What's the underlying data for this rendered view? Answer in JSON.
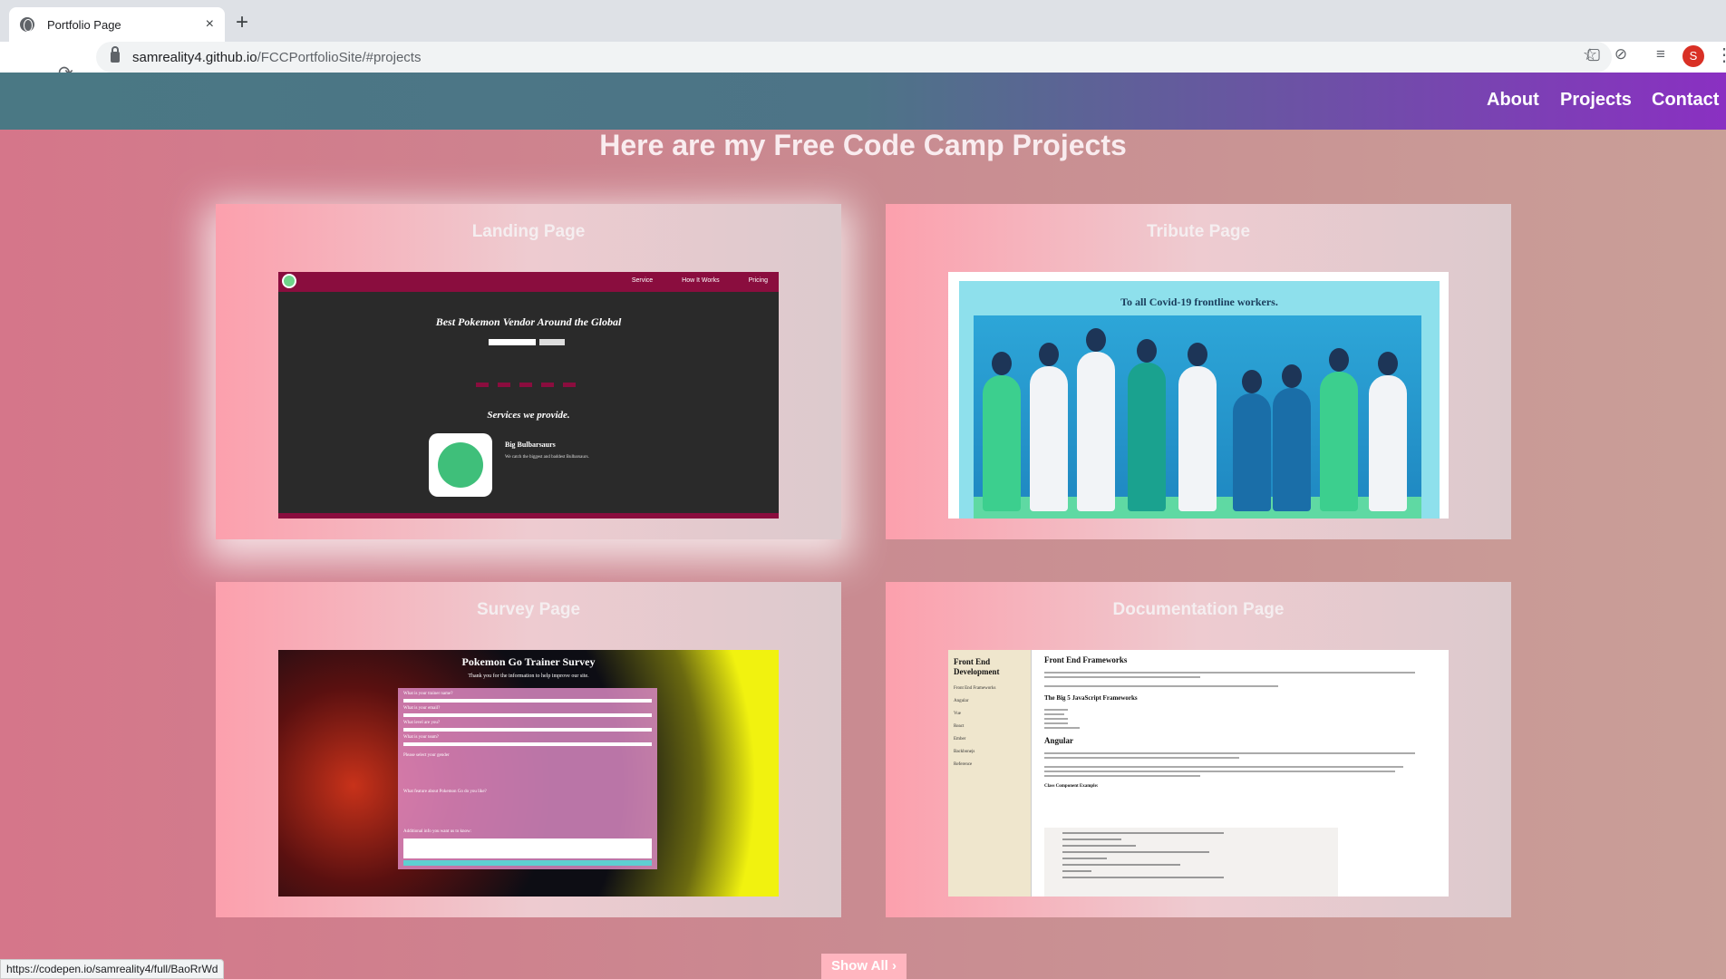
{
  "browser": {
    "tab_title": "Portfolio Page",
    "tab_close": "×",
    "new_tab": "+",
    "url_host": "samreality4.github.io",
    "url_path": "/FCCPortfolioSite/#projects",
    "back": "←",
    "forward": "→",
    "reload": "⟳",
    "star": "☆",
    "profile_initial": "S",
    "status_url": "https://codepen.io/samreality4/full/BaoRrWd"
  },
  "site": {
    "nav": [
      "About",
      "Projects",
      "Contact"
    ],
    "heading": "Here are my Free Code Camp Projects",
    "show_all": "Show All ›",
    "projects": [
      {
        "title": "Landing Page"
      },
      {
        "title": "Tribute Page"
      },
      {
        "title": "Survey Page"
      },
      {
        "title": "Documentation Page"
      }
    ]
  },
  "landing_thumb": {
    "nav": [
      "Service",
      "How It Works",
      "Pricing"
    ],
    "headline": "Best Pokemon Vendor Around the Global",
    "services": "Services we provide.",
    "item_name": "Big Bulbarsaurs",
    "item_desc": "We catch the biggest and baddest Bulbarsaurs."
  },
  "tribute_thumb": {
    "headline": "To all Covid-19 frontline workers."
  },
  "survey_thumb": {
    "headline": "Pokemon Go Trainer Survey",
    "sub": "Thank you for the information to help improve our site.",
    "labels": [
      "What is your trainer name?",
      "What is your email?",
      "What level are you?",
      "What is your team?",
      "Please select your gender",
      "What feature about Pokemon Go do you like?",
      "Additional info you want us to know:"
    ],
    "submit": "Submit"
  },
  "doc_thumb": {
    "side_title": "Front End Development",
    "side_items": [
      "Front End Frameworks",
      "Angular",
      "Vue",
      "React",
      "Ember",
      "Backbonejs",
      "Reference"
    ],
    "main_title": "Front End Frameworks",
    "subhead": "The Big 5 JavaScript Frameworks",
    "angular": "Angular",
    "code_label": "Class Component Example:"
  }
}
